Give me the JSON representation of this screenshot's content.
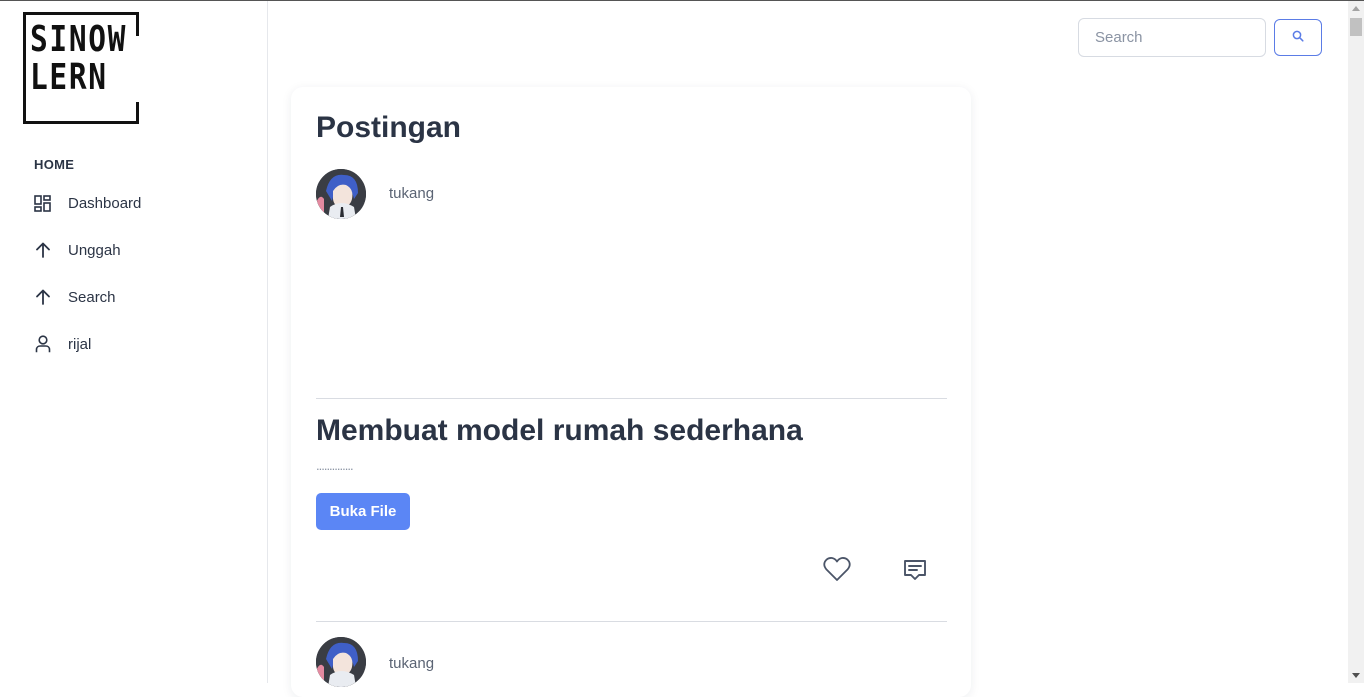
{
  "logo": {
    "line1": "SINOW",
    "line2": "LERN"
  },
  "sidebar": {
    "heading": "HOME",
    "items": [
      {
        "label": "Dashboard",
        "icon": "dashboard-icon"
      },
      {
        "label": "Unggah",
        "icon": "arrow-up-icon"
      },
      {
        "label": "Search",
        "icon": "arrow-up-icon"
      },
      {
        "label": "rijal",
        "icon": "user-icon"
      }
    ]
  },
  "search": {
    "placeholder": "Search",
    "value": ""
  },
  "feed": {
    "title": "Postingan",
    "posts": [
      {
        "author": "tukang",
        "title": "Membuat model rumah sederhana",
        "description": "..............",
        "button_label": "Buka File"
      },
      {
        "author": "tukang"
      }
    ]
  },
  "colors": {
    "accent": "#5b86f5",
    "text": "#2b3445",
    "muted": "#8a93a3"
  }
}
